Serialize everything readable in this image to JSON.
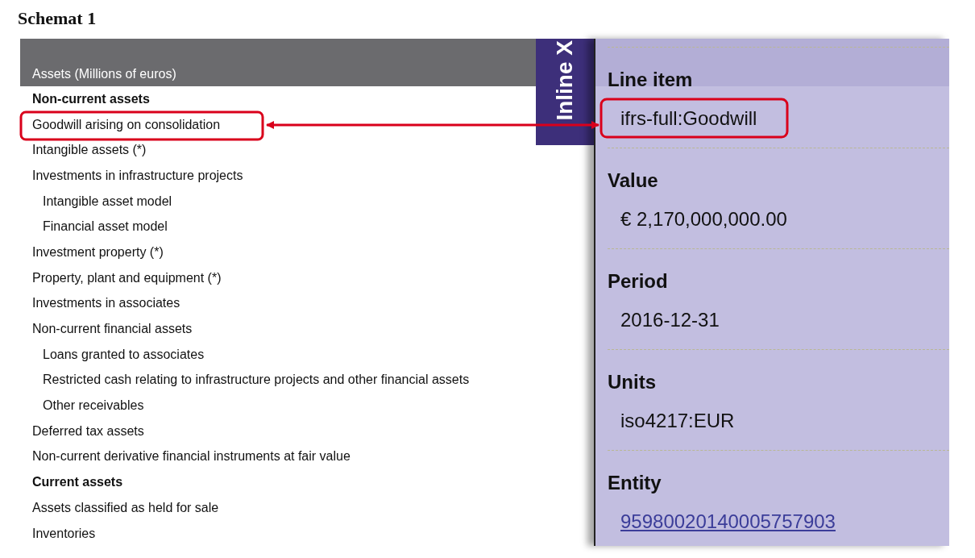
{
  "title": "Schemat 1",
  "table": {
    "columns": [
      "Assets (Millions of euros)"
    ],
    "rows": [
      {
        "label": "Non-current assets",
        "kind": "section"
      },
      {
        "label": "Goodwill arising on consolidation",
        "kind": "item"
      },
      {
        "label": "Intangible assets (*)",
        "kind": "item"
      },
      {
        "label": "Investments in infrastructure projects",
        "kind": "item",
        "children": [
          {
            "label": "Intangible asset model",
            "kind": "item"
          },
          {
            "label": "Financial asset model",
            "kind": "item"
          }
        ]
      },
      {
        "label": "Investment property (*)",
        "kind": "item"
      },
      {
        "label": "Property, plant and equipment (*)",
        "kind": "item"
      },
      {
        "label": "Investments in associates",
        "kind": "item"
      },
      {
        "label": "Non-current financial assets",
        "kind": "item",
        "children": [
          {
            "label": "Loans granted to associates",
            "kind": "item"
          },
          {
            "label": "Restricted cash relating to infrastructure projects and other financial assets",
            "kind": "item"
          },
          {
            "label": "Other receivables",
            "kind": "item"
          }
        ]
      },
      {
        "label": "Deferred tax assets",
        "kind": "item"
      },
      {
        "label": "Non-current derivative financial instruments at fair value",
        "kind": "item"
      },
      {
        "label": "Current assets",
        "kind": "section"
      },
      {
        "label": "Assets classified as held for sale",
        "kind": "item"
      },
      {
        "label": "Inventories",
        "kind": "item"
      }
    ]
  },
  "side_tab": {
    "label": "Inline X"
  },
  "fact_panel": {
    "fields": [
      {
        "label": "Line item",
        "value": "ifrs-full:Goodwill",
        "kind": "text"
      },
      {
        "label": "Value",
        "value": "€ 2,170,000,000.00",
        "kind": "text"
      },
      {
        "label": "Period",
        "value": "2016-12-31",
        "kind": "text"
      },
      {
        "label": "Units",
        "value": "iso4217:EUR",
        "kind": "text"
      },
      {
        "label": "Entity",
        "value": "959800201400057579​03",
        "kind": "link"
      }
    ]
  }
}
